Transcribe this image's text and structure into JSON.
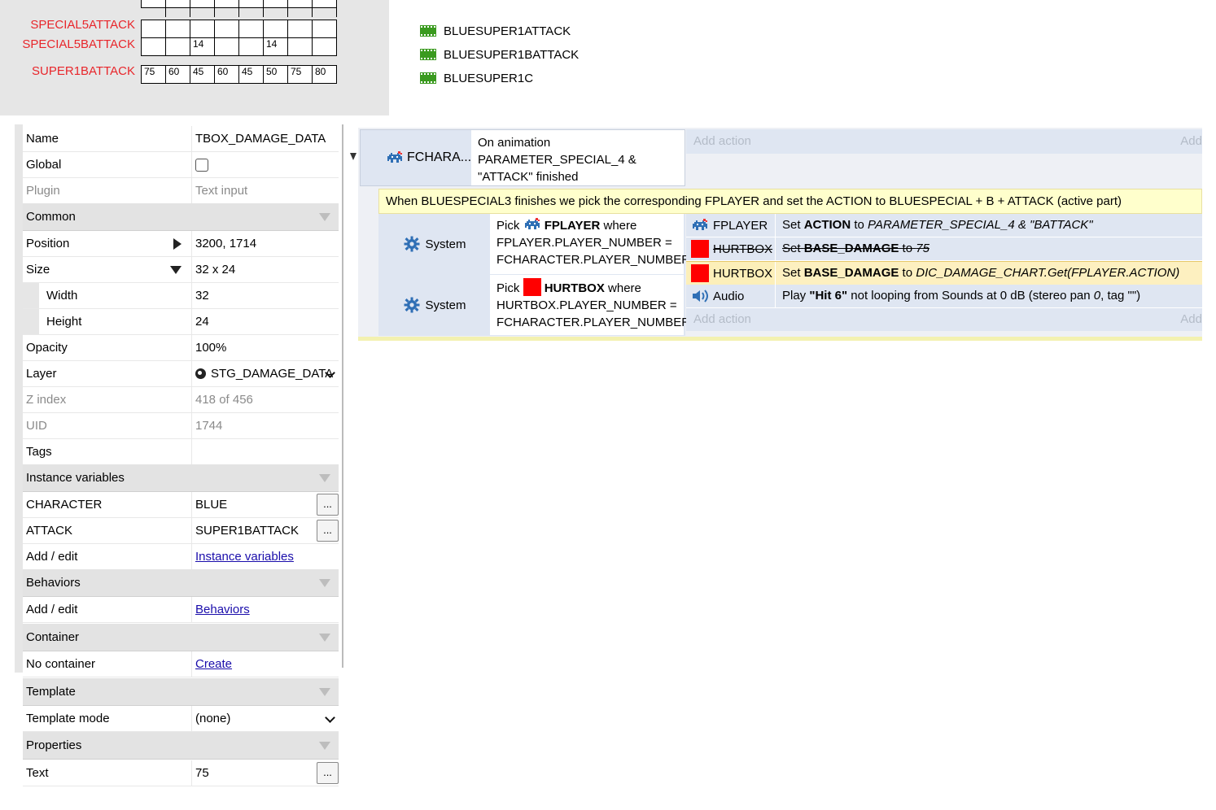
{
  "grid": {
    "rows": [
      {
        "label": "",
        "cells": [
          "",
          "",
          "",
          "",
          "",
          "",
          "",
          ""
        ]
      },
      {
        "label": "SPECIAL5ATTACK",
        "cells": [
          "",
          "",
          "",
          "",
          "",
          "",
          "",
          ""
        ]
      },
      {
        "label": "SPECIAL5BATTACK",
        "cells": [
          "",
          "",
          "14",
          "",
          "",
          "14",
          "",
          ""
        ]
      },
      {
        "label": "SUPER1BATTACK",
        "cells": [
          "75",
          "60",
          "45",
          "60",
          "45",
          "50",
          "75",
          "80"
        ]
      }
    ],
    "label_color": "#e8262b"
  },
  "assets": [
    {
      "name": "BLUESUPER1ATTACK",
      "icon": "film-strip-icon"
    },
    {
      "name": "BLUESUPER1BATTACK",
      "icon": "film-strip-icon"
    },
    {
      "name": "BLUESUPER1C",
      "icon": "film-strip-icon"
    }
  ],
  "properties": {
    "name": {
      "label": "Name",
      "value": "TBOX_DAMAGE_DATA"
    },
    "global": {
      "label": "Global",
      "checked": false
    },
    "plugin": {
      "label": "Plugin",
      "value": "Text input"
    },
    "common": {
      "label": "Common"
    },
    "position": {
      "label": "Position",
      "value": "3200, 1714"
    },
    "size": {
      "label": "Size",
      "value": "32 x 24"
    },
    "width": {
      "label": "Width",
      "value": "32"
    },
    "height": {
      "label": "Height",
      "value": "24"
    },
    "opacity": {
      "label": "Opacity",
      "value": "100%"
    },
    "layer": {
      "label": "Layer",
      "value": "STG_DAMAGE_DATA"
    },
    "zindex": {
      "label": "Z index",
      "value": "418 of 456"
    },
    "uid": {
      "label": "UID",
      "value": "1744"
    },
    "tags": {
      "label": "Tags",
      "value": ""
    },
    "instance_variables": {
      "label": "Instance variables"
    },
    "character": {
      "label": "CHARACTER",
      "value": "BLUE"
    },
    "attack": {
      "label": "ATTACK",
      "value": "SUPER1BATTACK"
    },
    "iv_add": {
      "label": "Add / edit",
      "link": "Instance variables"
    },
    "behaviors": {
      "label": "Behaviors"
    },
    "beh_add": {
      "label": "Add / edit",
      "link": "Behaviors"
    },
    "container": {
      "label": "Container"
    },
    "no_container": {
      "label": "No container",
      "link": "Create"
    },
    "template": {
      "label": "Template"
    },
    "template_mode": {
      "label": "Template mode",
      "value": "(none)"
    },
    "props": {
      "label": "Properties"
    },
    "text": {
      "label": "Text",
      "value": "75"
    },
    "ellipsis": "..."
  },
  "event_sheet": {
    "event1": {
      "object": "FCHARA...",
      "condition_lines": [
        "On animation",
        "PARAMETER_SPECIAL_4 &",
        "\"ATTACK\" finished"
      ],
      "add_action": "Add action",
      "add_right": "Add"
    },
    "comment": "When BLUESPECIAL3 finishes we pick the corresponding FPLAYER and set the ACTION to BLUESPECIAL + B + ATTACK (active part)",
    "sub_conditions": [
      {
        "object": "System",
        "pick": "Pick",
        "target": "FPLAYER",
        "where": "where",
        "line2": "FPLAYER.PLAYER_NUMBER =",
        "line3": "FCHARACTER.PLAYER_NUMBER"
      },
      {
        "object": "System",
        "pick": "Pick",
        "target": "HURTBOX",
        "where": "where",
        "line2": "HURTBOX.PLAYER_NUMBER =",
        "line3": "FCHARACTER.PLAYER_NUMBER"
      }
    ],
    "actions": [
      {
        "object": "FPLAYER",
        "set": "Set",
        "var": "ACTION",
        "to": "to",
        "value": "PARAMETER_SPECIAL_4 & \"BATTACK\"",
        "disabled": false,
        "selected": false
      },
      {
        "object": "HURTBOX",
        "set": "Set",
        "var": "BASE_DAMAGE",
        "to": "to",
        "value": "75",
        "disabled": true,
        "selected": false
      },
      {
        "object": "HURTBOX",
        "set": "Set",
        "var": "BASE_DAMAGE",
        "to": "to",
        "value": "DIC_DAMAGE_CHART.Get(FPLAYER.ACTION)",
        "disabled": false,
        "selected": true
      },
      {
        "object": "Audio",
        "play": "Play",
        "sound": "\"Hit 6\"",
        "rest": "not looping from Sounds at 0 dB (stereo pan",
        "pan": "0",
        "tag": ", tag \"\")"
      }
    ],
    "add_action": "Add action",
    "add_right": "Add"
  },
  "colors": {
    "panel_gray": "#e3e3e3",
    "event_blue": "#dfe6f2",
    "comment_yellow": "#ffffcc",
    "selected_row": "#fcefb9",
    "hurtbox_red": "#ff0000",
    "film_green": "#3a9a1f",
    "link": "#1a0dab"
  }
}
